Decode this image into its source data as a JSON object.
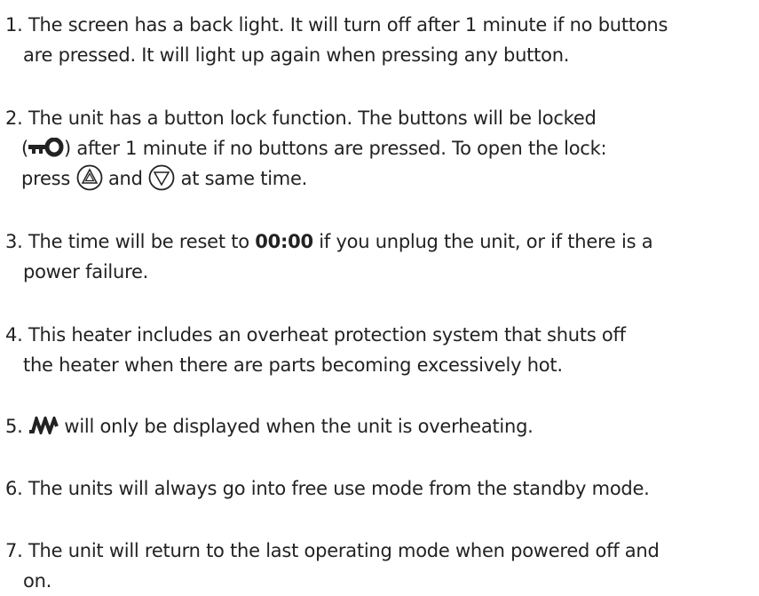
{
  "notes": [
    {
      "number": "1.",
      "lines": [
        "The screen has a back light. It will turn off after 1 minute if no buttons",
        "are pressed. It will light up again when pressing any button."
      ]
    },
    {
      "number": "2.",
      "line1": "The unit has a button lock function. The buttons will be locked",
      "line2_open": "(",
      "line2_rest": ") after 1 minute if no buttons are pressed. To open the lock:",
      "line3_press": "press",
      "line3_and": "and",
      "line3_end": "at same time."
    },
    {
      "number": "3.",
      "line1_pre": "The time will be reset to",
      "line1_bold": "00:00",
      "line1_post": "if you unplug the unit, or if there is a",
      "line2": "power failure."
    },
    {
      "number": "4.",
      "lines": [
        "This heater includes an overheat protection system that shuts off",
        "the heater when there are parts becoming excessively hot."
      ]
    },
    {
      "number": "5.",
      "text": "will only be displayed when the unit is overheating."
    },
    {
      "number": "6.",
      "text": "The units will always go into free use mode from the standby mode."
    },
    {
      "number": "7.",
      "lines": [
        "The unit will return to the last operating mode when powered off and",
        "on."
      ]
    }
  ],
  "icons": {
    "lock": "key-lock-icon",
    "up": "up-triangle-button-icon",
    "down": "down-triangle-button-icon",
    "overheat": "heating-element-icon"
  },
  "colors": {
    "text": "#222222"
  }
}
